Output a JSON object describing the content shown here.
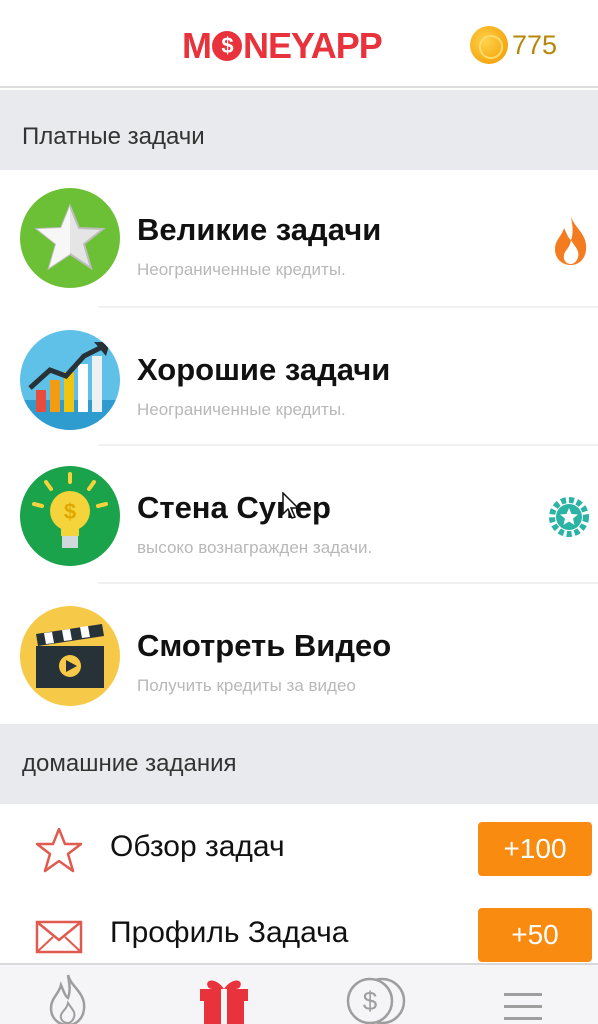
{
  "header": {
    "logo_prefix": "M",
    "logo_o": "$",
    "logo_suffix": "NEYAPP",
    "coin_count": "775",
    "coin_icon": "gold-coin-icon"
  },
  "paid_section": {
    "title": "Платные задачи"
  },
  "tasks": [
    {
      "title": "Великие задачи",
      "subtitle": "Неограниченные кредиты.",
      "icon": "star-icon",
      "badge": "flame-icon"
    },
    {
      "title": "Хорошие задачи",
      "subtitle": "Неограниченные кредиты.",
      "icon": "growth-chart-icon",
      "badge": ""
    },
    {
      "title": "Стена Супер",
      "subtitle": "высоко вознагражден задачи.",
      "icon": "lightbulb-icon",
      "badge": "star-gear-icon"
    },
    {
      "title": "Смотреть Видео",
      "subtitle": "Получить кредиты за видео",
      "icon": "clapperboard-icon",
      "badge": ""
    }
  ],
  "home_section": {
    "title": "домашние задания"
  },
  "home_tasks": [
    {
      "label": "Обзор задач",
      "reward": "+100",
      "icon": "star-outline-icon"
    },
    {
      "label": "Профиль Задача",
      "reward": "+50",
      "icon": "envelope-icon"
    }
  ],
  "tabbar": {
    "tabs": [
      {
        "icon": "flame-tab-icon",
        "active": false
      },
      {
        "icon": "gift-icon",
        "active": true
      },
      {
        "icon": "coins-icon",
        "active": false
      },
      {
        "icon": "menu-icon",
        "active": false
      }
    ]
  },
  "colors": {
    "brand": "#e8323c",
    "accent_orange": "#f98b11",
    "section_bg": "#e9eaee",
    "teal": "#2bb3a6"
  }
}
